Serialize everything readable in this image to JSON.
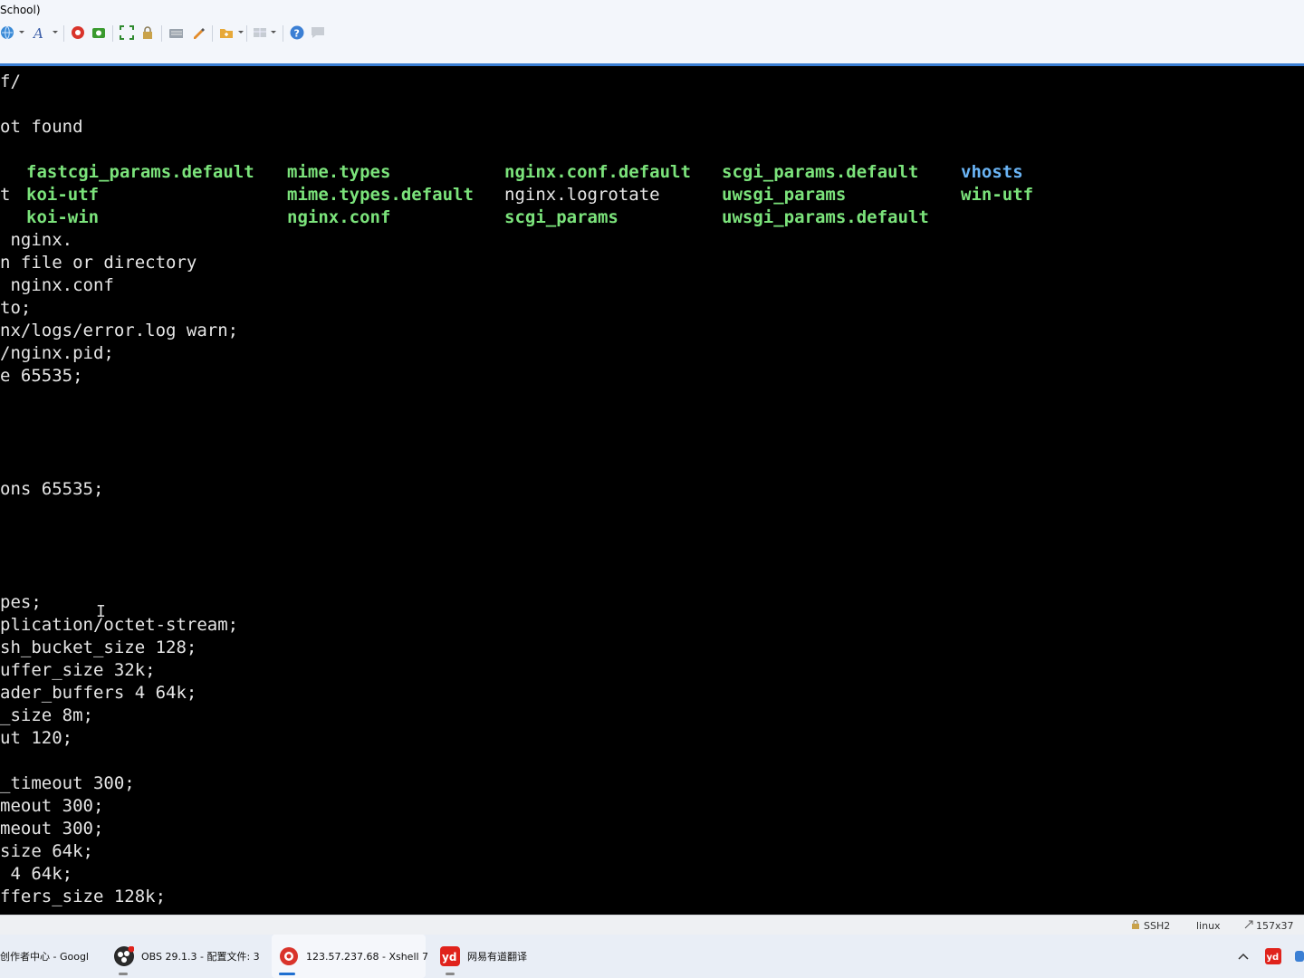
{
  "window": {
    "title_fragment": "School)"
  },
  "toolbar": {
    "icons": [
      "globe-icon",
      "font-icon",
      "xshell-icon",
      "new-session-icon",
      "fullscreen-icon",
      "lock-icon",
      "keyboard-icon",
      "highlight-icon",
      "folder-icon",
      "layout-icon",
      "help-icon",
      "chat-icon"
    ]
  },
  "terminal": {
    "lines": [
      "f/",
      "",
      "ot found",
      "",
      "",
      "t",
      "",
      " nginx.",
      "n file or directory",
      " nginx.conf",
      "to;",
      "nx/logs/error.log warn;",
      "/nginx.pid;",
      "e 65535;",
      "",
      "",
      "",
      "",
      "ons 65535;",
      "",
      "",
      "",
      "",
      "pes;",
      "plication/octet-stream;",
      "sh_bucket_size 128;",
      "uffer_size 32k;",
      "ader_buffers 4 64k;",
      "_size 8m;",
      "ut 120;",
      "",
      "_timeout 300;",
      "meout 300;",
      "meout 300;",
      "size 64k;",
      " 4 64k;",
      "ffers_size 128k;"
    ],
    "listing": [
      [
        "fastcgi_params.default",
        "mime.types",
        "nginx.conf.default",
        "scgi_params.default",
        "vhosts"
      ],
      [
        "koi-utf",
        "mime.types.default",
        "nginx.logrotate",
        "uwsgi_params",
        "win-utf"
      ],
      [
        "koi-win",
        "nginx.conf",
        "scgi_params",
        "uwsgi_params.default",
        ""
      ]
    ],
    "cursor_glyph": "I"
  },
  "statusbar": {
    "protocol": "SSH2",
    "os": "linux",
    "size": "157x37"
  },
  "taskbar": {
    "items": [
      {
        "label": "创作者中心 - Googl"
      },
      {
        "label": "OBS 29.1.3 - 配置文件: 3"
      },
      {
        "label": "123.57.237.68 - Xshell 7"
      },
      {
        "label": "网易有道翻译"
      }
    ],
    "tray_up_arrow": "^"
  },
  "colors": {
    "terminal_bg": "#000000",
    "terminal_fg": "#e6e6e6",
    "file_green": "#7be37b",
    "dir_blue": "#6ab4f5",
    "accent": "#3b7fd4"
  }
}
